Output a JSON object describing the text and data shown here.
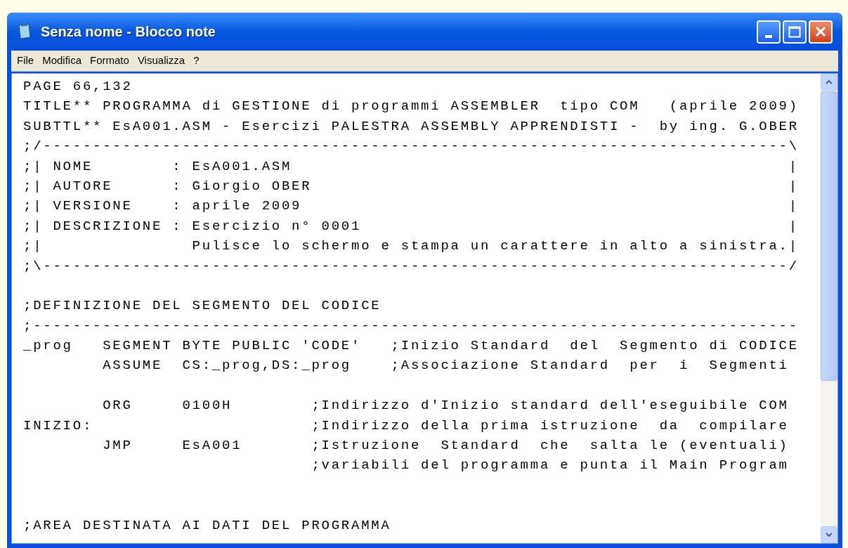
{
  "window": {
    "title": "Senza nome - Blocco note"
  },
  "menu": [
    "File",
    "Modifica",
    "Formato",
    "Visualizza",
    "?"
  ],
  "editor": {
    "lines": [
      {
        "kind": "text",
        "text": "PAGE 66,132"
      },
      {
        "kind": "text",
        "text": "TITLE** PROGRAMMA di GESTIONE di programmi ASSEMBLER  tipo COM   (aprile 2009)"
      },
      {
        "kind": "text",
        "text": "SUBTTL** EsA001.ASM - Esercizi PALESTRA ASSEMBLY APPRENDISTI -  by ing. G.OBER"
      },
      {
        "kind": "text",
        "text": ";/---------------------------------------------------------------------------\\"
      },
      {
        "kind": "text",
        "text": ";| NOME        : EsA001.ASM                                                  |"
      },
      {
        "kind": "text",
        "text": ";| AUTORE      : Giorgio OBER                                                |"
      },
      {
        "kind": "text",
        "text": ";| VERSIONE    : aprile 2009                                                 |"
      },
      {
        "kind": "text",
        "text": ";| DESCRIZIONE : Esercizio n° 0001                                           |"
      },
      {
        "kind": "text",
        "text": ";|               Pulisce lo schermo e stampa un carattere in alto a sinistra.|"
      },
      {
        "kind": "text",
        "text": ";\\---------------------------------------------------------------------------/"
      },
      {
        "kind": "blank"
      },
      {
        "kind": "text",
        "text": ";DEFINIZIONE DEL SEGMENTO DEL CODICE"
      },
      {
        "kind": "text",
        "text": ";-----------------------------------------------------------------------------"
      },
      {
        "kind": "text",
        "text": "_prog   SEGMENT BYTE PUBLIC 'CODE'   ;Inizio Standard  del  Segmento di CODICE"
      },
      {
        "kind": "text",
        "text": "        ASSUME  CS:_prog,DS:_prog    ;Associazione Standard  per  i  Segmenti"
      },
      {
        "kind": "blank"
      },
      {
        "kind": "text",
        "text": "        ORG     0100H        ;Indirizzo d'Inizio standard dell'eseguibile COM"
      },
      {
        "kind": "text",
        "text": "INIZIO:                      ;Indirizzo della prima istruzione  da  compilare"
      },
      {
        "kind": "text",
        "text": "        JMP     EsA001       ;Istruzione  Standard  che  salta le (eventuali)"
      },
      {
        "kind": "text",
        "text": "                             ;variabili del programma e punta il Main Program"
      },
      {
        "kind": "blank"
      },
      {
        "kind": "blank"
      },
      {
        "kind": "text",
        "text": ";AREA DESTINATA AI DATI DEL PROGRAMMA"
      }
    ]
  }
}
